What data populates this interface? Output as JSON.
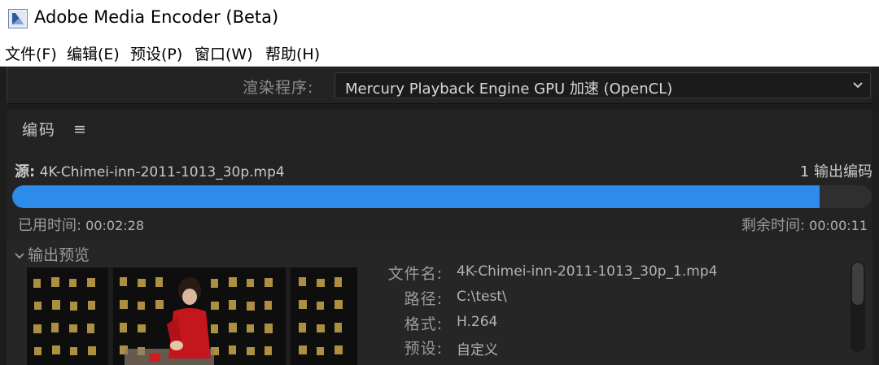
{
  "window": {
    "title": "Adobe Media Encoder (Beta)"
  },
  "menubar": {
    "items": [
      {
        "label": "文件(F)"
      },
      {
        "label": "编辑(E)"
      },
      {
        "label": "预设(P)"
      },
      {
        "label": "窗口(W)"
      },
      {
        "label": "帮助(H)"
      }
    ]
  },
  "renderer": {
    "label": "渲染程序:",
    "value": "Mercury Playback Engine GPU 加速 (OpenCL)"
  },
  "encode": {
    "header": "编码",
    "menu_icon": "hamburger-menu-icon",
    "source_label": "源:",
    "source_file": "4K-Chimei-inn-2011-1013_30p.mp4",
    "output_count": "1 输出编码",
    "progress_percent": 93.9,
    "progress_color": "#2d8ceb",
    "elapsed_label": "已用时间:",
    "elapsed_value": "00:02:28",
    "remaining_label": "剩余时间:",
    "remaining_value": "00:00:11"
  },
  "preview": {
    "header": "输出预览",
    "info": [
      {
        "label": "文件名:",
        "value": "4K-Chimei-inn-2011-1013_30p_1.mp4"
      },
      {
        "label": "路径:",
        "value": "C:\\test\\"
      },
      {
        "label": "格式:",
        "value": "H.264"
      },
      {
        "label": "预设:",
        "value": "自定义"
      }
    ]
  }
}
